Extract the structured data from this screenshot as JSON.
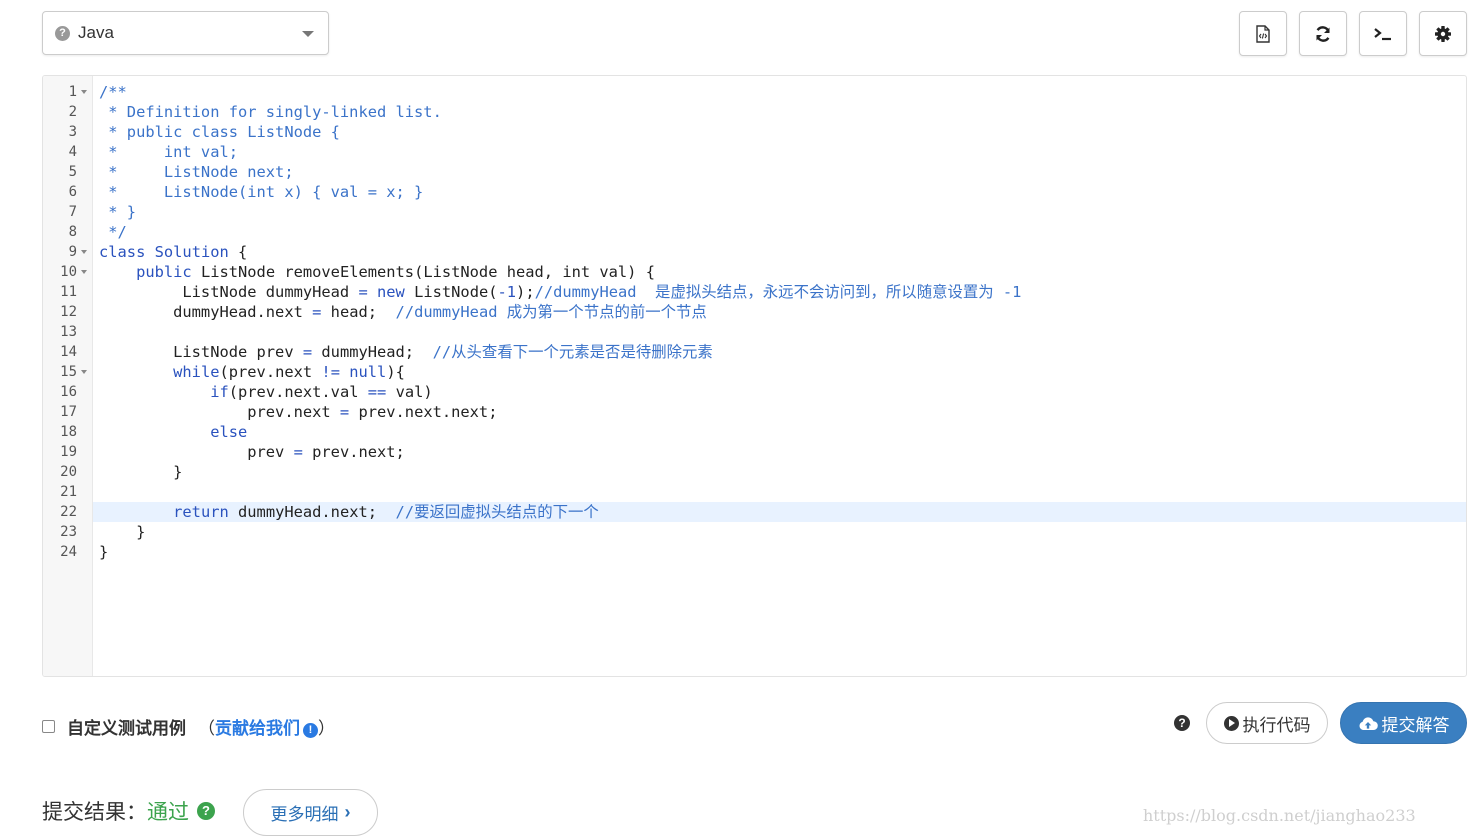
{
  "toolbar": {
    "language": "Java",
    "icons": [
      "code-file-icon",
      "refresh-icon",
      "terminal-icon",
      "gear-icon"
    ]
  },
  "editor": {
    "active_line": 22,
    "lines": [
      {
        "n": "1",
        "fold": true,
        "segs": [
          {
            "c": "cm",
            "t": "/**"
          }
        ]
      },
      {
        "n": "2",
        "segs": [
          {
            "c": "cm",
            "t": " * Definition for singly-linked list."
          }
        ]
      },
      {
        "n": "3",
        "segs": [
          {
            "c": "cm",
            "t": " * public class ListNode {"
          }
        ]
      },
      {
        "n": "4",
        "segs": [
          {
            "c": "cm",
            "t": " *     int val;"
          }
        ]
      },
      {
        "n": "5",
        "segs": [
          {
            "c": "cm",
            "t": " *     ListNode next;"
          }
        ]
      },
      {
        "n": "6",
        "segs": [
          {
            "c": "cm",
            "t": " *     ListNode(int x) { val = x; }"
          }
        ]
      },
      {
        "n": "7",
        "segs": [
          {
            "c": "cm",
            "t": " * }"
          }
        ]
      },
      {
        "n": "8",
        "segs": [
          {
            "c": "cm",
            "t": " */"
          }
        ]
      },
      {
        "n": "9",
        "fold": true,
        "segs": [
          {
            "c": "kw",
            "t": "class"
          },
          {
            "c": "tx",
            "t": " "
          },
          {
            "c": "kw",
            "t": "Solution"
          },
          {
            "c": "tx",
            "t": " {"
          }
        ]
      },
      {
        "n": "10",
        "fold": true,
        "segs": [
          {
            "c": "tx",
            "t": "    "
          },
          {
            "c": "kw",
            "t": "public"
          },
          {
            "c": "tx",
            "t": " ListNode removeElements(ListNode head, int val) {"
          }
        ]
      },
      {
        "n": "11",
        "segs": [
          {
            "c": "tx",
            "t": "         ListNode dummyHead "
          },
          {
            "c": "kw",
            "t": "="
          },
          {
            "c": "tx",
            "t": " "
          },
          {
            "c": "kw",
            "t": "new"
          },
          {
            "c": "tx",
            "t": " ListNode("
          },
          {
            "c": "kw",
            "t": "-1"
          },
          {
            "c": "tx",
            "t": ");"
          },
          {
            "c": "cm",
            "t": "//dummyHead  是虚拟头结点，永远不会访问到，所以随意设置为 -1"
          }
        ]
      },
      {
        "n": "12",
        "segs": [
          {
            "c": "tx",
            "t": "        dummyHead.next "
          },
          {
            "c": "kw",
            "t": "="
          },
          {
            "c": "tx",
            "t": " head;  "
          },
          {
            "c": "cm",
            "t": "//dummyHead 成为第一个节点的前一个节点"
          }
        ]
      },
      {
        "n": "13",
        "segs": []
      },
      {
        "n": "14",
        "segs": [
          {
            "c": "tx",
            "t": "        ListNode prev "
          },
          {
            "c": "kw",
            "t": "="
          },
          {
            "c": "tx",
            "t": " dummyHead;  "
          },
          {
            "c": "cm",
            "t": "//从头查看下一个元素是否是待删除元素"
          }
        ]
      },
      {
        "n": "15",
        "fold": true,
        "segs": [
          {
            "c": "tx",
            "t": "        "
          },
          {
            "c": "kw",
            "t": "while"
          },
          {
            "c": "tx",
            "t": "(prev.next "
          },
          {
            "c": "kw",
            "t": "!="
          },
          {
            "c": "tx",
            "t": " "
          },
          {
            "c": "kw",
            "t": "null"
          },
          {
            "c": "tx",
            "t": "){"
          }
        ]
      },
      {
        "n": "16",
        "segs": [
          {
            "c": "tx",
            "t": "            "
          },
          {
            "c": "kw",
            "t": "if"
          },
          {
            "c": "tx",
            "t": "(prev.next.val "
          },
          {
            "c": "kw",
            "t": "=="
          },
          {
            "c": "tx",
            "t": " val)"
          }
        ]
      },
      {
        "n": "17",
        "segs": [
          {
            "c": "tx",
            "t": "                prev.next "
          },
          {
            "c": "kw",
            "t": "="
          },
          {
            "c": "tx",
            "t": " prev.next.next;"
          }
        ]
      },
      {
        "n": "18",
        "segs": [
          {
            "c": "tx",
            "t": "            "
          },
          {
            "c": "kw",
            "t": "else"
          }
        ]
      },
      {
        "n": "19",
        "segs": [
          {
            "c": "tx",
            "t": "                prev "
          },
          {
            "c": "kw",
            "t": "="
          },
          {
            "c": "tx",
            "t": " prev.next;"
          }
        ]
      },
      {
        "n": "20",
        "segs": [
          {
            "c": "tx",
            "t": "        }"
          }
        ]
      },
      {
        "n": "21",
        "segs": []
      },
      {
        "n": "22",
        "segs": [
          {
            "c": "tx",
            "t": "        "
          },
          {
            "c": "kw",
            "t": "return"
          },
          {
            "c": "tx",
            "t": " dummyHead.next;  "
          },
          {
            "c": "cm",
            "t": "//要返回虚拟头结点的下一个"
          }
        ]
      },
      {
        "n": "23",
        "segs": [
          {
            "c": "tx",
            "t": "    }"
          }
        ]
      },
      {
        "n": "24",
        "segs": [
          {
            "c": "tx",
            "t": "}"
          }
        ]
      }
    ]
  },
  "footer": {
    "custom_test_label": "自定义测试用例",
    "contribute_open": "（",
    "contribute_link": "贡献给我们",
    "contribute_close": "）",
    "help_glyph": "?",
    "run_label": "执行代码",
    "submit_label": "提交解答",
    "result_label": "提交结果：",
    "result_status": "通过",
    "more_label": "更多明细",
    "watermark": "https://blog.csdn.net/jianghao233"
  },
  "colors": {
    "comment": "#3b73c9",
    "keyword": "#2a52be",
    "submit_bg": "#3a7fc1",
    "success": "#3ca34d",
    "active_line_bg": "#e8f2ff"
  }
}
